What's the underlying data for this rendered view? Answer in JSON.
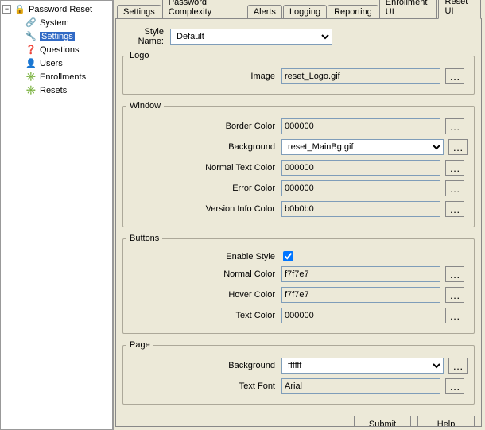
{
  "tree": {
    "root": "Password Reset",
    "items": [
      "System",
      "Settings",
      "Questions",
      "Users",
      "Enrollments",
      "Resets"
    ],
    "selected": "Settings"
  },
  "tabs": [
    "Settings",
    "Password Complexity",
    "Alerts",
    "Logging",
    "Reporting",
    "Enrollment UI",
    "Reset UI"
  ],
  "activeTab": "Reset UI",
  "form": {
    "styleName": {
      "label": "Style Name:",
      "value": "Default"
    },
    "logo": {
      "legend": "Logo",
      "image": {
        "label": "Image",
        "value": "reset_Logo.gif"
      }
    },
    "window": {
      "legend": "Window",
      "borderColor": {
        "label": "Border Color",
        "value": "000000"
      },
      "background": {
        "label": "Background",
        "value": "reset_MainBg.gif"
      },
      "normalTextColor": {
        "label": "Normal Text Color",
        "value": "000000"
      },
      "errorColor": {
        "label": "Error Color",
        "value": "000000"
      },
      "versionInfoColor": {
        "label": "Version Info Color",
        "value": "b0b0b0"
      }
    },
    "buttons": {
      "legend": "Buttons",
      "enableStyle": {
        "label": "Enable Style",
        "checked": true
      },
      "normalColor": {
        "label": "Normal Color",
        "value": "f7f7e7"
      },
      "hoverColor": {
        "label": "Hover Color",
        "value": "f7f7e7"
      },
      "textColor": {
        "label": "Text Color",
        "value": "000000"
      }
    },
    "page": {
      "legend": "Page",
      "background": {
        "label": "Background",
        "value": "ffffff"
      },
      "textFont": {
        "label": "Text Font",
        "value": "Arial"
      }
    }
  },
  "footer": {
    "submit": "Submit",
    "help": "Help"
  }
}
